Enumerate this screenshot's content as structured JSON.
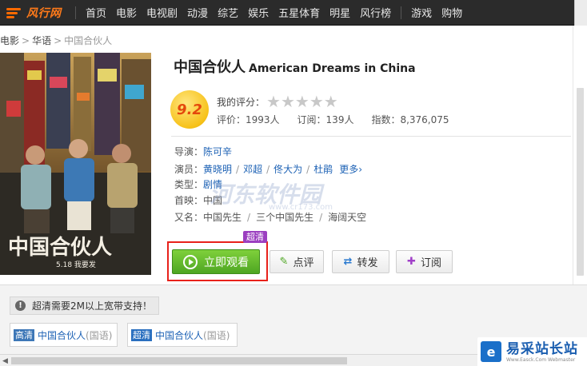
{
  "nav": {
    "logo": "风行网",
    "items": [
      "首页",
      "电影",
      "电视剧",
      "动漫",
      "综艺",
      "娱乐",
      "五星体育",
      "明星",
      "风行榜"
    ],
    "extra_items": [
      "游戏",
      "购物"
    ]
  },
  "breadcrumb": [
    "电影",
    "华语",
    "中国合伙人"
  ],
  "movie": {
    "title_cn": "中国合伙人",
    "title_en": "American Dreams in China",
    "score": "9.2",
    "my_rating_label": "我的评分：",
    "stars": 5,
    "stats": {
      "reviews": "评价：1993人",
      "subscriptions": "订阅：139人",
      "index": "指数：8,376,075"
    },
    "director_label": "导演：",
    "director": "陈可辛",
    "cast_label": "演员：",
    "cast": [
      "黄晓明",
      "邓超",
      "佟大为",
      "杜鹃"
    ],
    "more": "更多›",
    "genre_label": "类型：",
    "genre": "剧情",
    "release_label": "首映：",
    "release": "中国",
    "alias_label": "又名：",
    "aliases": [
      "中国先生",
      "三个中国先生",
      "海阔天空"
    ]
  },
  "actions": {
    "hd_tag": "超清",
    "watch": "立即观看",
    "review": "点评",
    "share": "转发",
    "subscribe": "订阅"
  },
  "lower": {
    "notice": "超清需要2M以上宽带支持！",
    "episodes": [
      {
        "quality": "高清",
        "quality_color": "#3d77b7",
        "name": "中国合伙人",
        "lang": "(国语)"
      },
      {
        "quality": "超清",
        "quality_color": "#2a6fbf",
        "name": "中国合伙人",
        "lang": "(国语)"
      }
    ]
  },
  "watermark": {
    "overlay_text": "河东软件园",
    "overlay_url": "www.cr173.com",
    "site_name": "易采站长站",
    "site_url": "Www.Easck.Com Webmaster"
  },
  "colors": {
    "nav_bg": "#2b2b2b",
    "accent_orange": "#ff7a1a",
    "link_blue": "#1d62b5",
    "watch_green": "#5bb52a",
    "highlight_red": "#e8211a",
    "hd_tag_purple": "#9b3fc0"
  }
}
